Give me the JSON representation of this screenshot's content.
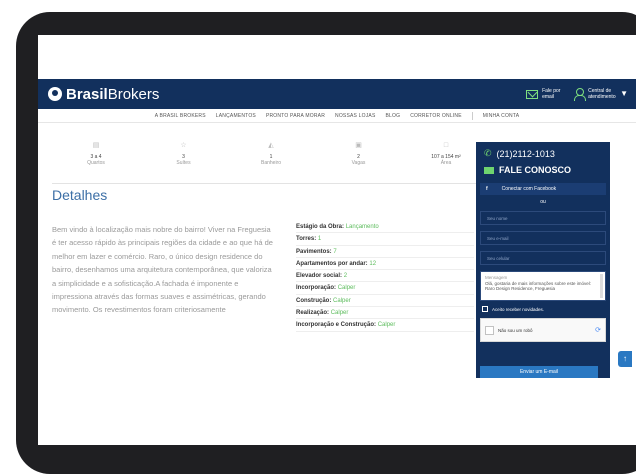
{
  "header": {
    "logo_prefix": "Brasil",
    "logo_suffix": "Brokers",
    "email_label": "Fale por email",
    "central_label": "Central de atendimento"
  },
  "nav": {
    "items": [
      "A Brasil Brokers",
      "Lançamentos",
      "Pronto para morar",
      "Nossas lojas",
      "Blog",
      "Corretor online",
      "Minha conta"
    ]
  },
  "stats": [
    {
      "value": "3 a 4",
      "label": "Quartos",
      "icon": "bed-icon"
    },
    {
      "value": "3",
      "label": "Suítes",
      "icon": "star-icon"
    },
    {
      "value": "1",
      "label": "Banheiro",
      "icon": "bath-icon"
    },
    {
      "value": "2",
      "label": "Vagas",
      "icon": "car-icon"
    },
    {
      "value": "107 a 154 m²",
      "label": "Área",
      "icon": "area-icon"
    }
  ],
  "details": {
    "title": "Detalhes",
    "description": "Bem vindo à localização mais nobre do bairro! Viver na Freguesia é ter acesso rápido às principais regiões da cidade e ao que há de melhor em lazer e comércio. Raro, o único design residence do bairro, desenhamos uma arquitetura contemporânea, que valoriza a simplicidade e a sofisticação.A fachada é imponente e impressiona através das formas suaves e assimétricas, gerando movimento. Os revestimentos foram criteriosamente"
  },
  "specs": [
    {
      "label": "Estágio da Obra:",
      "value": "Lançamento"
    },
    {
      "label": "Torres:",
      "value": "1"
    },
    {
      "label": "Pavimentos:",
      "value": "7"
    },
    {
      "label": "Apartamentos por andar:",
      "value": "12"
    },
    {
      "label": "Elevador social:",
      "value": "2"
    },
    {
      "label": "Incorporação:",
      "value": "Calper"
    },
    {
      "label": "Construção:",
      "value": "Calper"
    },
    {
      "label": "Realização:",
      "value": "Calper"
    },
    {
      "label": "Incorporação e Construção:",
      "value": "Calper"
    }
  ],
  "sidebar": {
    "phone": "(21)2112-1013",
    "contact_title": "FALE CONOSCO",
    "facebook_button": "Conectar com Facebook",
    "or_label": "ou",
    "name_placeholder": "Seu nome",
    "email_placeholder": "Seu e-mail",
    "phone_placeholder": "Seu celular",
    "message_label": "Mensagem",
    "message_value": "Olá, gostaria de mais informações sobre este imóvel: Raro Design Residence, Freguesia",
    "newsletter_label": "Aceito receber novidades.",
    "captcha_label": "Não sou um robô",
    "send_button": "Enviar um E-mail"
  },
  "colors": {
    "brand_navy": "#12305d",
    "accent_green": "#5cbc5c",
    "title_blue": "#3c6fa6"
  }
}
